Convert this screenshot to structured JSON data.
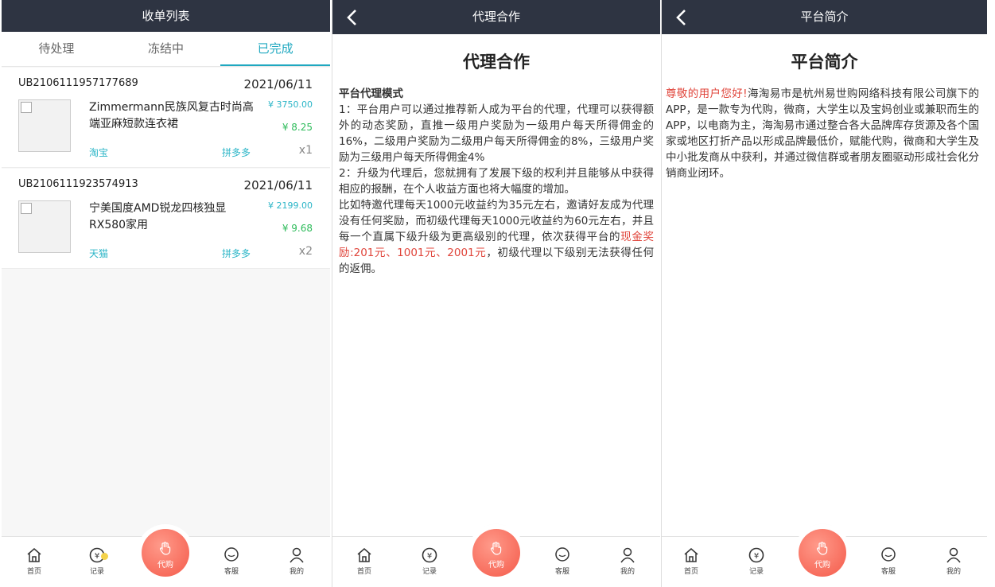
{
  "screens": {
    "orders": {
      "title": "收单列表",
      "tabs": [
        "待处理",
        "冻结中",
        "已完成"
      ],
      "orders": [
        {
          "order_no": "UB2106111957177689",
          "date": "2021/06/11",
          "name": "Zimmermann民族风复古时尚高端亚麻短款连衣裙",
          "price": "¥ 3750.00",
          "commission": "¥ 8.25",
          "platform": "淘宝",
          "source": "拼多多",
          "qty": "x1"
        },
        {
          "order_no": "UB2106111923574913",
          "date": "2021/06/11",
          "name": "宁美国度AMD锐龙四核独显RX580家用",
          "price": "¥ 2199.00",
          "commission": "¥ 9.68",
          "platform": "天猫",
          "source": "拼多多",
          "qty": "x2"
        }
      ]
    },
    "agency": {
      "header": "代理合作",
      "title": "代理合作",
      "heading": "平台代理模式",
      "p1": "1：平台用户可以通过推荐新人成为平台的代理，代理可以获得额外的动态奖励，直推一级用户奖励为一级用户每天所得佣金的16%，二级用户奖励为二级用户每天所得佣金的8%，三级用户奖励为三级用户每天所得佣金4%",
      "p2": "2：升级为代理后，您就拥有了发展下级的权利并且能够从中获得相应的报酬，在个人收益方面也将大幅度的增加。",
      "p3_pre": "比如特邀代理每天1000元收益约为35元左右，邀请好友成为代理没有任何奖励，而初级代理每天1000元收益约为60元左右，并且每一个直属下级升级为更高级别的代理，依次获得平台的",
      "p3_red": "现金奖励:201元、1001元、2001元",
      "p3_post": "，初级代理以下级别无法获得任何的返佣。"
    },
    "intro": {
      "header": "平台简介",
      "title": "平台简介",
      "greeting": "尊敬的用户您好!",
      "body": "海淘易市是杭州易世购网络科技有限公司旗下的APP，是一款专为代购，微商，大学生以及宝妈创业或兼职而生的APP，以电商为主，海淘易市通过整合各大品牌库存货源及各个国家或地区打折产品以形成品牌最低价，赋能代购，微商和大学生及中小批发商从中获利，并通过微信群或者朋友圈驱动形成社会化分销商业闭环。"
    }
  },
  "nav": {
    "home": "首页",
    "records": "记录",
    "daigou": "代购",
    "service": "客服",
    "mine": "我的"
  },
  "colors": {
    "topbar": "#2e3442",
    "accent": "#1fa8c0",
    "price": "#2bb5c7",
    "commission": "#2dbb5a",
    "highlight": "#e0453b",
    "fab": "#f45a4a"
  },
  "icons": {
    "back": "chevron-left-icon",
    "home": "home-icon",
    "records": "yen-coin-icon",
    "daigou": "hand-icon",
    "service": "chat-icon",
    "mine": "user-icon"
  }
}
